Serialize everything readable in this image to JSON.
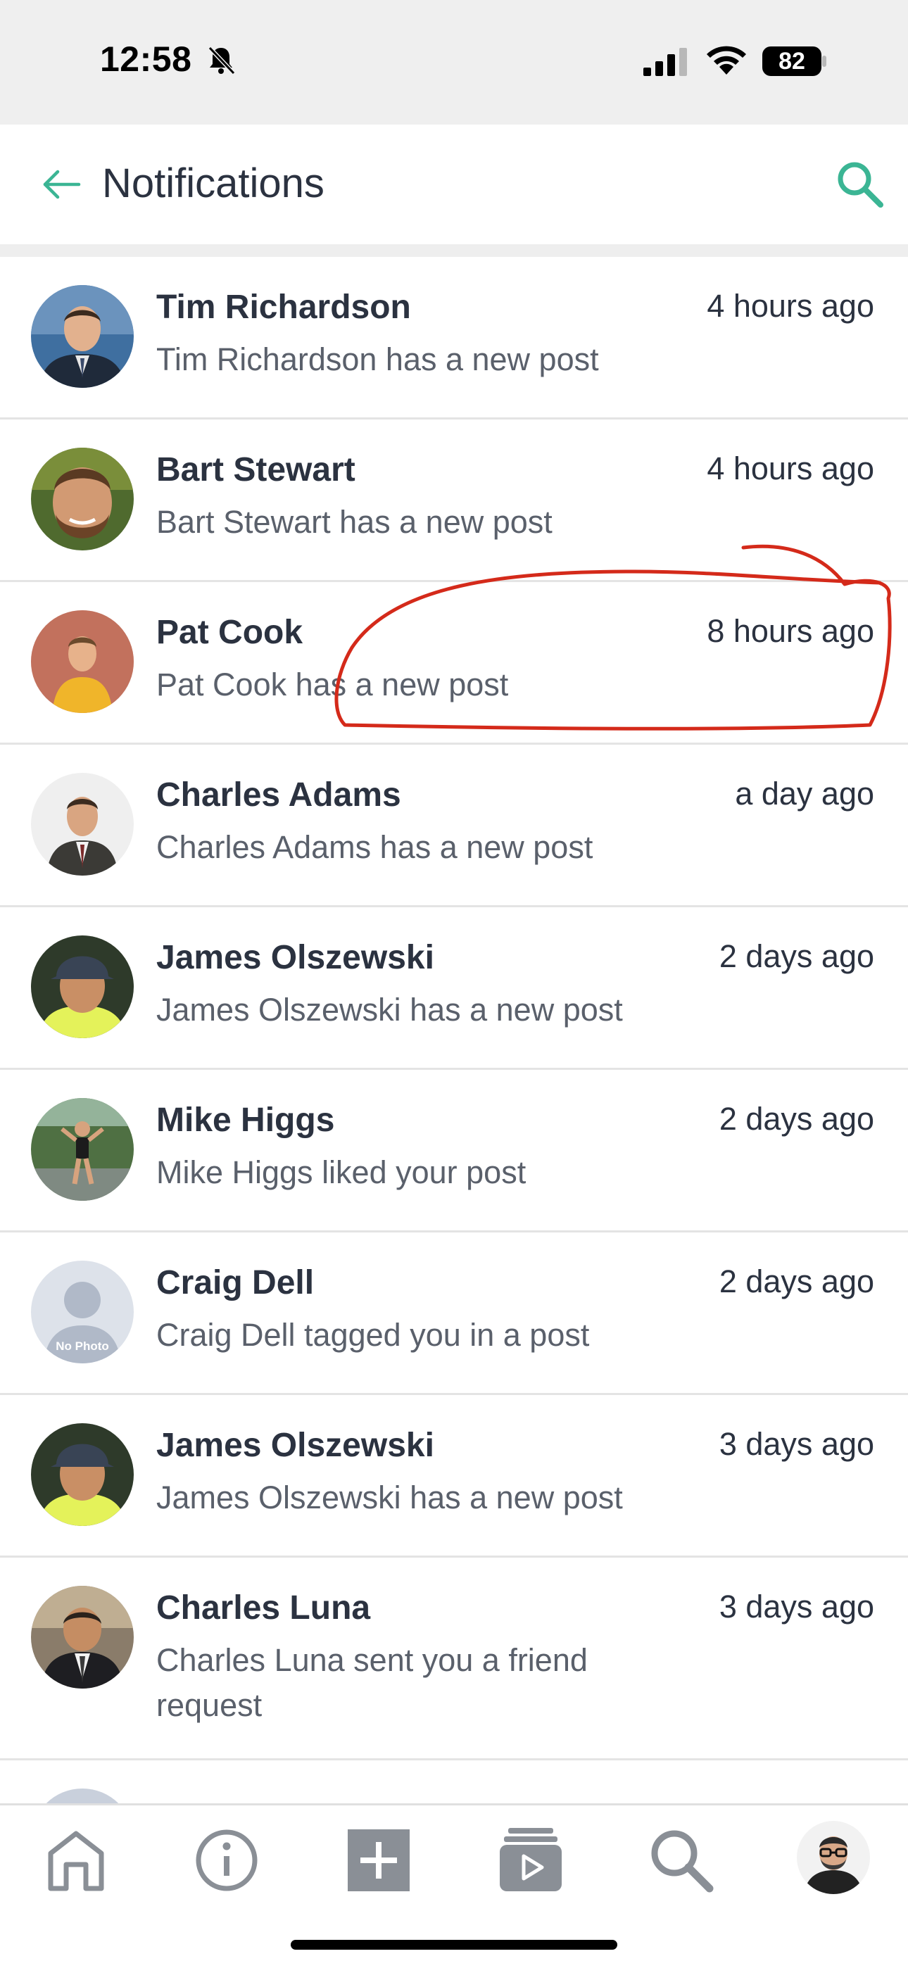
{
  "status_bar": {
    "time": "12:58",
    "battery": "82",
    "icons": [
      "bell-off-icon",
      "cellular-signal-icon",
      "wifi-icon",
      "battery-icon"
    ]
  },
  "header": {
    "title": "Notifications",
    "back_icon": "arrow-left-icon",
    "search_icon": "search-icon",
    "accent_color": "#3bb594"
  },
  "notifications": [
    {
      "name": "Tim Richardson",
      "time": "4 hours ago",
      "message": "Tim Richardson has a new post",
      "avatar": "photo"
    },
    {
      "name": "Bart Stewart",
      "time": "4 hours ago",
      "message": "Bart Stewart has a new post",
      "avatar": "photo"
    },
    {
      "name": "Pat Cook",
      "time": "8 hours ago",
      "message": "Pat Cook has a new post",
      "avatar": "photo"
    },
    {
      "name": "Charles Adams",
      "time": "a day ago",
      "message": "Charles Adams has a new post",
      "avatar": "photo"
    },
    {
      "name": "James Olszewski",
      "time": "2 days ago",
      "message": "James Olszewski has a new post",
      "avatar": "photo"
    },
    {
      "name": "Mike Higgs",
      "time": "2 days ago",
      "message": "Mike Higgs liked your post",
      "avatar": "photo"
    },
    {
      "name": "Craig Dell",
      "time": "2 days ago",
      "message": "Craig Dell tagged you in a post",
      "avatar": "placeholder",
      "placeholder_text": "No Photo"
    },
    {
      "name": "James Olszewski",
      "time": "3 days ago",
      "message": "James Olszewski has a new post",
      "avatar": "photo"
    },
    {
      "name": "Charles Luna",
      "time": "3 days ago",
      "message": "Charles Luna sent you a friend request",
      "avatar": "photo"
    }
  ],
  "annotation": {
    "color": "#d42a1a",
    "target": "Pat Cook"
  },
  "bottom_nav": {
    "items": [
      "home-icon",
      "info-icon",
      "add-post-icon",
      "video-library-icon",
      "search-icon",
      "profile-avatar"
    ]
  }
}
